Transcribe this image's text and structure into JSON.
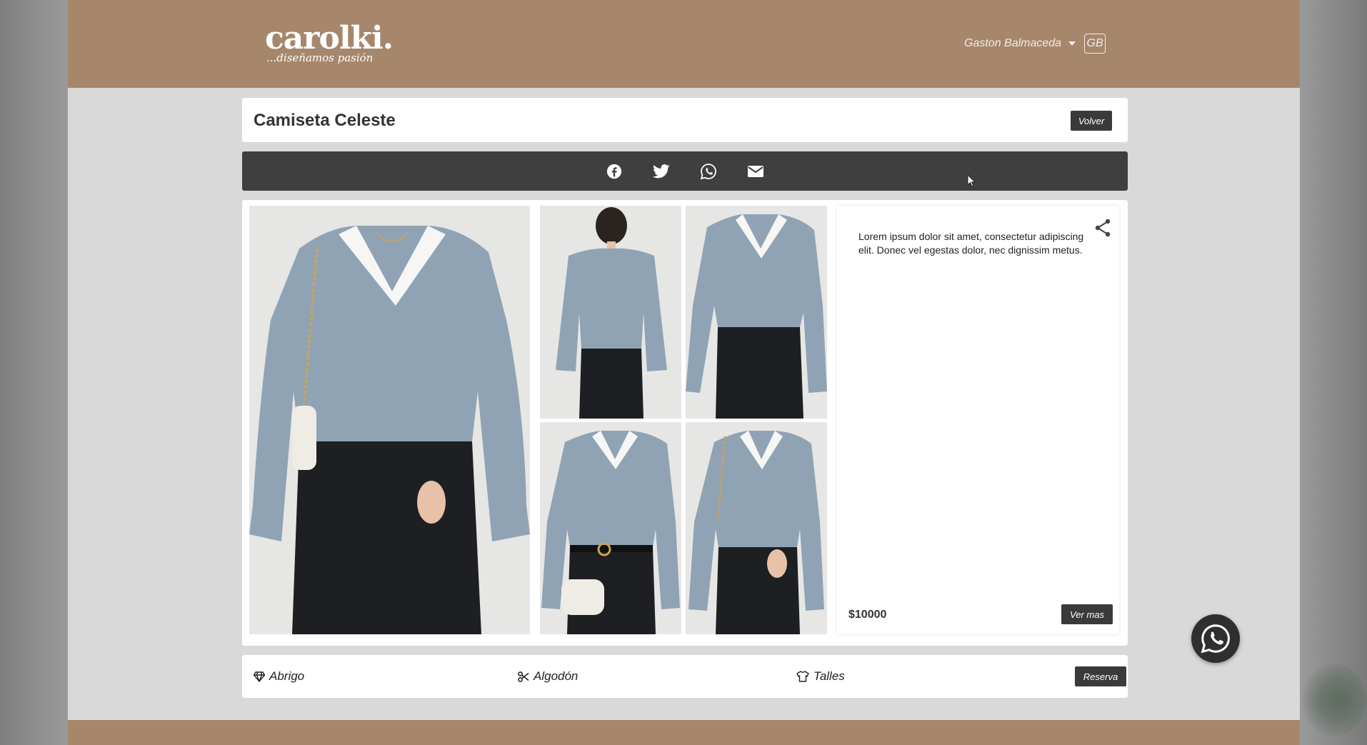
{
  "header": {
    "brand": "carolki.",
    "tagline": "...diseñamos pasión",
    "user_name": "Gaston Balmaceda",
    "user_initials": "GB"
  },
  "product": {
    "title": "Camiseta Celeste",
    "back_label": "Volver",
    "description": "Lorem ipsum dolor sit amet, consectetur adipiscing elit. Donec vel egestas dolor, nec dignissim metus.",
    "price": "$10000",
    "more_label": "Ver mas"
  },
  "share": {
    "icons": [
      "facebook-icon",
      "twitter-icon",
      "whatsapp-icon",
      "email-icon"
    ]
  },
  "features": {
    "type_label": "Abrigo",
    "material_label": "Algodón",
    "sizes_label": "Talles",
    "reserve_label": "Reserva"
  },
  "colors": {
    "header_bg": "#a6876c",
    "page_bg": "#d9d9d9",
    "share_bar": "#3f3f3f",
    "button_dark": "#3a3a3a",
    "garment": "#8fa3b5"
  }
}
